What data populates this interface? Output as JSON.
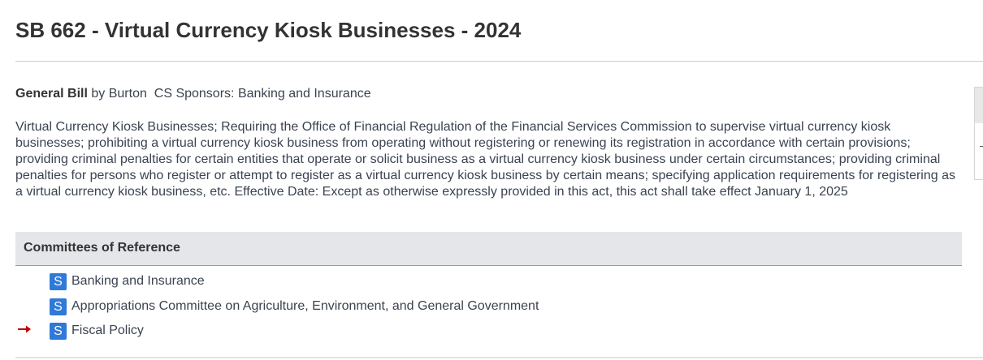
{
  "bill": {
    "title": "SB 662 - Virtual Currency Kiosk Businesses - 2024",
    "bill_type": "General Bill",
    "by_label": "by",
    "sponsor": "Burton",
    "cs_sponsors_label": "CS Sponsors:",
    "cs_sponsors": "Banking and Insurance",
    "description": "Virtual Currency Kiosk Businesses; Requiring the Office of Financial Regulation of the Financial Services Commission to supervise virtual currency kiosk businesses; prohibiting a virtual currency kiosk business from operating without registering or renewing its registration in accordance with certain provisions; providing criminal penalties for certain entities that operate or solicit business as a virtual currency kiosk business under certain circumstances; providing criminal penalties for persons who register or attempt to register as a virtual currency kiosk business by certain means; specifying application requirements for registering as a virtual currency kiosk business, etc. Effective Date: Except as otherwise expressly provided in this act, this act shall take effect January 1, 2025"
  },
  "committees": {
    "header": "Committees of Reference",
    "items": [
      {
        "chamber": "S",
        "name": "Banking and Insurance",
        "current": false
      },
      {
        "chamber": "S",
        "name": "Appropriations Committee on Agriculture, Environment, and General Government",
        "current": false
      },
      {
        "chamber": "S",
        "name": "Fiscal Policy",
        "current": true
      }
    ]
  },
  "colors": {
    "chamber_badge": "#2f7ad8",
    "current_arrow": "#c00000",
    "header_background": "#e5e6e9"
  },
  "icons": {
    "current_indicator": "right-arrow-icon"
  }
}
